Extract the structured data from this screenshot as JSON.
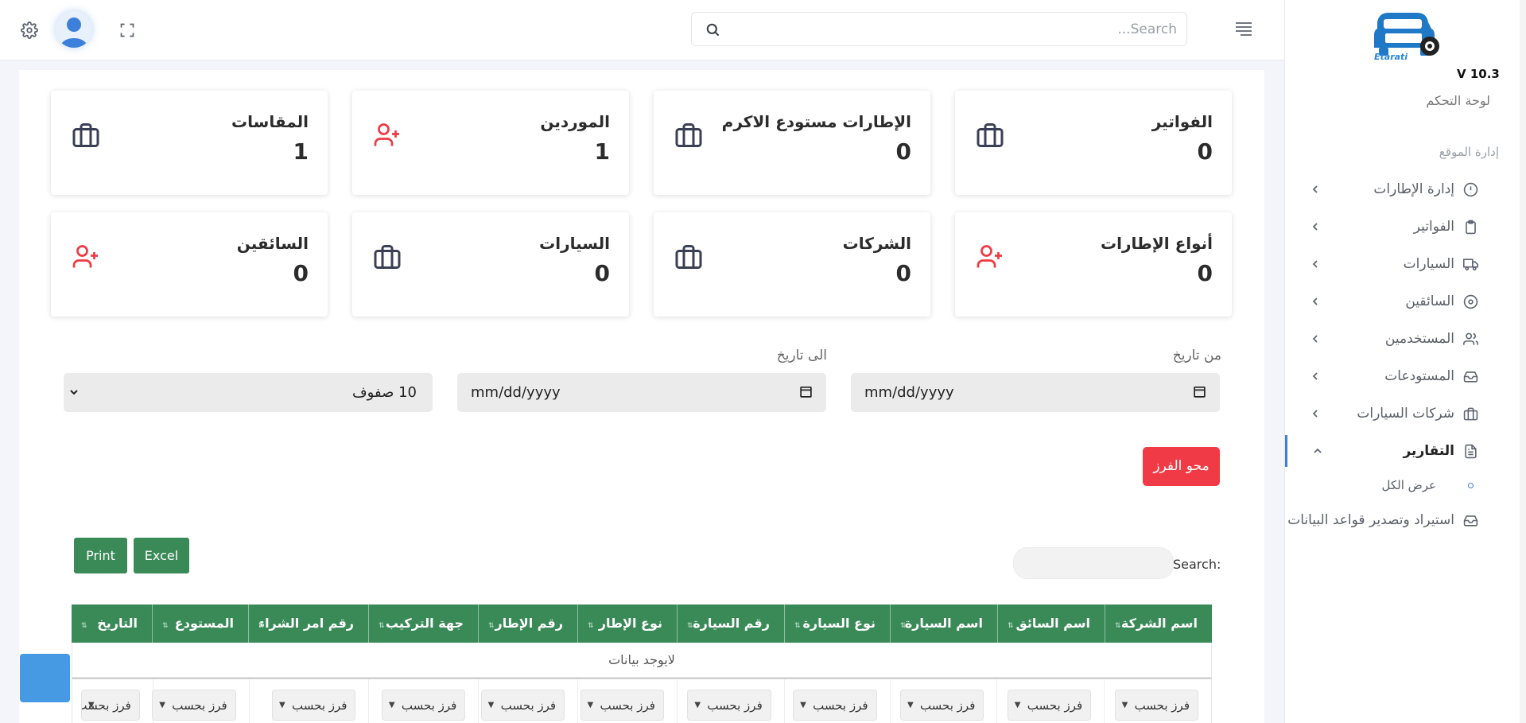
{
  "topbar": {
    "search_placeholder": "Search..."
  },
  "sidebar": {
    "logo_text": "Etarati",
    "version": "V 10.3",
    "dashboard_label": "لوحة التحكم",
    "section_title": "إدارة الموقع",
    "items": [
      {
        "label": "إدارة الإطارات",
        "icon": "alert-circle-icon"
      },
      {
        "label": "الفواتير",
        "icon": "clipboard-icon"
      },
      {
        "label": "السيارات",
        "icon": "truck-icon"
      },
      {
        "label": "السائقين",
        "icon": "disc-icon"
      },
      {
        "label": "المستخدمين",
        "icon": "users-icon"
      },
      {
        "label": "المستودعات",
        "icon": "inbox-icon"
      },
      {
        "label": "شركات السيارات",
        "icon": "briefcase-icon"
      },
      {
        "label": "التقارير",
        "icon": "file-text-icon"
      },
      {
        "label": "استيراد وتصدير قواعد البيانات",
        "icon": "inbox-icon"
      }
    ],
    "sub_item": "عرض الكل"
  },
  "cards": [
    {
      "title": "الفواتير",
      "value": "0",
      "icon": "briefcase-icon"
    },
    {
      "title": "الإطارات مستودع الاكرم",
      "value": "0",
      "icon": "briefcase-icon"
    },
    {
      "title": "الموردين",
      "value": "1",
      "icon": "user-plus-icon"
    },
    {
      "title": "المقاسات",
      "value": "1",
      "icon": "briefcase-icon"
    },
    {
      "title": "أنواع الإطارات",
      "value": "0",
      "icon": "user-plus-icon"
    },
    {
      "title": "الشركات",
      "value": "0",
      "icon": "briefcase-icon"
    },
    {
      "title": "السيارات",
      "value": "0",
      "icon": "briefcase-icon"
    },
    {
      "title": "السائقين",
      "value": "0",
      "icon": "user-plus-icon"
    }
  ],
  "filters": {
    "from_label": "من تاريخ",
    "to_label": "الى تاريخ",
    "from_value": "mm/dd/yyyy",
    "to_value": "mm/dd/yyyy",
    "rows_select": "10 صفوف"
  },
  "buttons": {
    "clear_sort": "محو الفرز",
    "print": "Print",
    "excel": "Excel"
  },
  "table": {
    "search_label": "Search:",
    "columns": [
      "اسم الشركة",
      "اسم السائق",
      "اسم السيارة",
      "نوع السيارة",
      "رقم السيارة",
      "نوع الإطار",
      "رقم الإطار",
      "جهة التركيب",
      "رقم امر الشراء",
      "المستودع",
      "التاريخ"
    ],
    "empty_text": "لايوجد بيانات",
    "filter_label": "فرز بحسب",
    "sort_glyph": "⇅",
    "dropdown_glyph": "▼"
  },
  "colors": {
    "accent": "#3d80db",
    "table_header": "#3a8a58",
    "danger": "#f03a45",
    "icon_red": "#ef3a43"
  }
}
